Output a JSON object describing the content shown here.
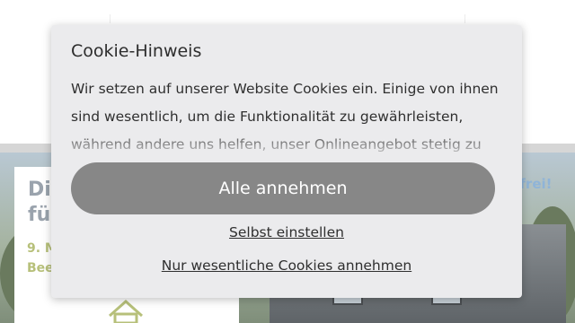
{
  "background": {
    "card_title": "Die für",
    "card_subtitle": "9. M Bee",
    "right_text": "t frei!"
  },
  "cookie": {
    "title": "Cookie-Hinweis",
    "text": "Wir setzen auf unserer Website Cookies ein. Einige von ihnen sind wesentlich, um die Funktionalität zu gewährleisten, während andere uns helfen, unser Onlineangebot stetig zu",
    "accept_all_label": "Alle annehmen",
    "customize_label": "Selbst einstellen",
    "essential_only_label": "Nur wesentliche Cookies annehmen"
  },
  "colors": {
    "dialog_bg": "#ebebed",
    "button_bg": "#878787",
    "button_text": "#ffffff"
  }
}
